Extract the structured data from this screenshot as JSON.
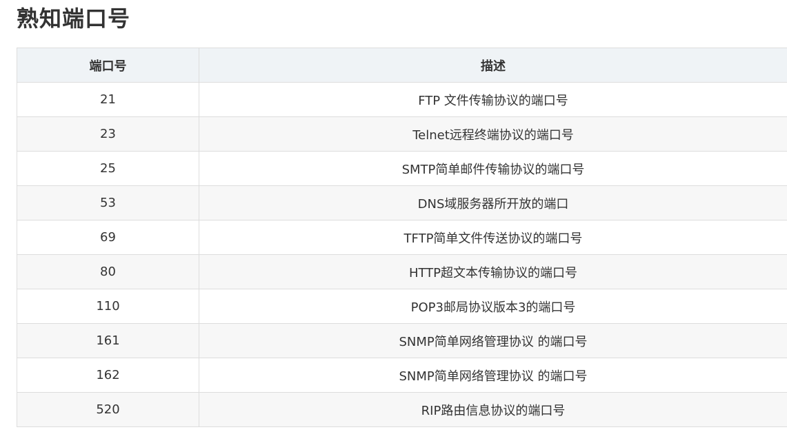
{
  "title": "熟知端口号",
  "table": {
    "headers": {
      "port": "端口号",
      "description": "描述"
    },
    "rows": [
      {
        "port": "21",
        "description": "FTP 文件传输协议的端口号"
      },
      {
        "port": "23",
        "description": "Telnet远程终端协议的端口号"
      },
      {
        "port": "25",
        "description": "SMTP简单邮件传输协议的端口号"
      },
      {
        "port": "53",
        "description": "DNS域服务器所开放的端口"
      },
      {
        "port": "69",
        "description": "TFTP简单文件传送协议的端口号"
      },
      {
        "port": "80",
        "description": "HTTP超文本传输协议的端口号"
      },
      {
        "port": "110",
        "description": "POP3邮局协议版本3的端口号"
      },
      {
        "port": "161",
        "description": "SNMP简单网络管理协议 的端口号"
      },
      {
        "port": "162",
        "description": "SNMP简单网络管理协议 的端口号"
      },
      {
        "port": "520",
        "description": "RIP路由信息协议的端口号"
      }
    ]
  }
}
